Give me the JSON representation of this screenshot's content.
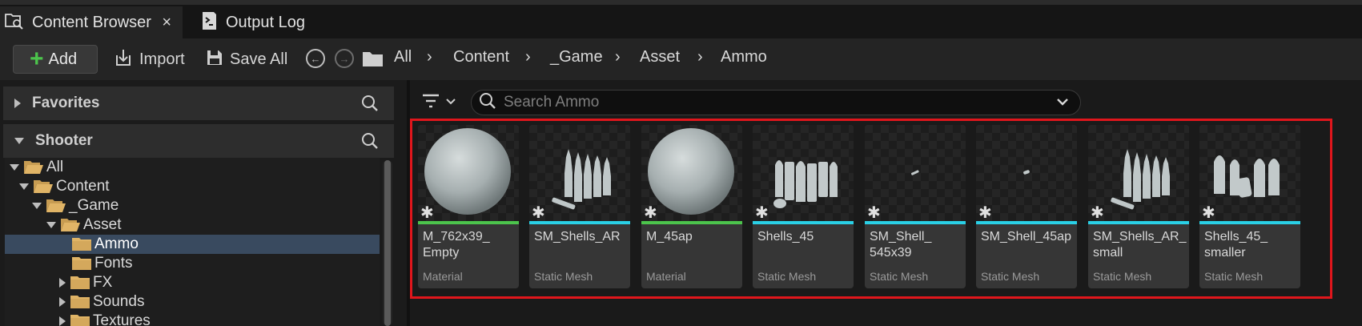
{
  "tabs": [
    {
      "label": "Content Browser",
      "icon": "folder-search-icon",
      "active": true,
      "close": "×"
    },
    {
      "label": "Output Log",
      "icon": "output-log-icon",
      "active": false
    }
  ],
  "toolbar": {
    "add_label": "Add",
    "import_label": "Import",
    "save_all_label": "Save All"
  },
  "breadcrumb": [
    "All",
    "Content",
    "_Game",
    "Asset",
    "Ammo"
  ],
  "favorites": {
    "label": "Favorites"
  },
  "shooter": {
    "label": "Shooter"
  },
  "tree": [
    {
      "label": "All",
      "depth": 0,
      "expanded": true
    },
    {
      "label": "Content",
      "depth": 1,
      "expanded": true
    },
    {
      "label": "_Game",
      "depth": 2,
      "expanded": true
    },
    {
      "label": "Asset",
      "depth": 3,
      "expanded": true
    },
    {
      "label": "Ammo",
      "depth": 4,
      "selected": true
    },
    {
      "label": "Fonts",
      "depth": 4
    },
    {
      "label": "FX",
      "depth": 4,
      "collapsed": true
    },
    {
      "label": "Sounds",
      "depth": 4,
      "collapsed": true
    },
    {
      "label": "Textures",
      "depth": 4,
      "collapsed": true
    }
  ],
  "search": {
    "placeholder": "Search Ammo"
  },
  "colors": {
    "material": "#4cc44c",
    "static_mesh": "#2ad0e6",
    "highlight": "#e0161c"
  },
  "assets": [
    {
      "name": "M_762x39_ Empty",
      "type": "Material",
      "thumb": "sphere"
    },
    {
      "name": "SM_Shells_AR",
      "type": "Static Mesh",
      "thumb": "ar-shells"
    },
    {
      "name": "M_45ap",
      "type": "Material",
      "thumb": "sphere"
    },
    {
      "name": "Shells_45",
      "type": "Static Mesh",
      "thumb": "45-shells"
    },
    {
      "name": "SM_Shell_ 545x39",
      "type": "Static Mesh",
      "thumb": "tiny-shell"
    },
    {
      "name": "SM_Shell_45ap",
      "type": "Static Mesh",
      "thumb": "tiny-shell"
    },
    {
      "name": "SM_Shells_AR_ small",
      "type": "Static Mesh",
      "thumb": "ar-shells"
    },
    {
      "name": "Shells_45_ smaller",
      "type": "Static Mesh",
      "thumb": "45-shells-small"
    }
  ]
}
